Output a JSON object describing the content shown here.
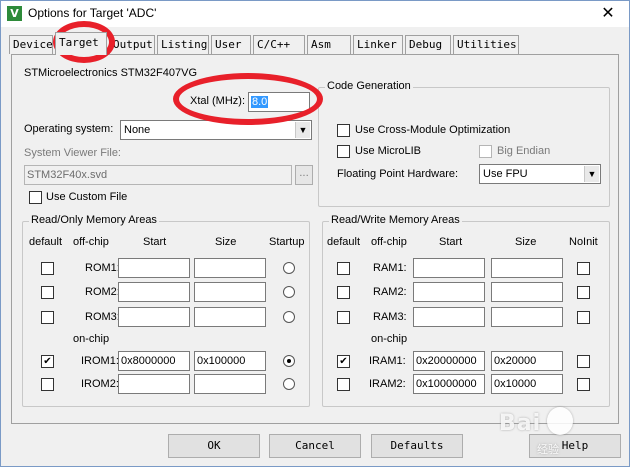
{
  "window": {
    "title": "Options for Target 'ADC'",
    "close_glyph": "✕",
    "app_icon_glyph": "V"
  },
  "tabs": [
    "Device",
    "Target",
    "Output",
    "Listing",
    "User",
    "C/C++",
    "Asm",
    "Linker",
    "Debug",
    "Utilities"
  ],
  "active_tab": "Target",
  "target": {
    "device_name": "STMicroelectronics STM32F407VG",
    "xtal_label": "Xtal (MHz):",
    "xtal_value": "8.0",
    "os_label": "Operating system:",
    "os_value": "None",
    "svf_label": "System Viewer File:",
    "svf_value": "STM32F40x.svd",
    "browse_label": "...",
    "custom_file_label": "Use Custom File",
    "custom_file_checked": false
  },
  "codegen": {
    "title": "Code Generation",
    "cross_module_label": "Use Cross-Module Optimization",
    "cross_module_checked": false,
    "microlib_label": "Use MicroLIB",
    "microlib_checked": false,
    "big_endian_label": "Big Endian",
    "big_endian_checked": false,
    "fpu_label": "Floating Point Hardware:",
    "fpu_value": "Use FPU"
  },
  "rom_areas": {
    "title": "Read/Only Memory Areas",
    "headers": {
      "default": "default",
      "offchip": "off-chip",
      "start": "Start",
      "size": "Size",
      "startup": "Startup"
    },
    "onchip_label": "on-chip",
    "rows": [
      {
        "name": "ROM1:",
        "default": false,
        "start": "",
        "size": "",
        "startup": false
      },
      {
        "name": "ROM2:",
        "default": false,
        "start": "",
        "size": "",
        "startup": false
      },
      {
        "name": "ROM3:",
        "default": false,
        "start": "",
        "size": "",
        "startup": false
      },
      {
        "name": "IROM1:",
        "default": true,
        "start": "0x8000000",
        "size": "0x100000",
        "startup": true
      },
      {
        "name": "IROM2:",
        "default": false,
        "start": "",
        "size": "",
        "startup": false
      }
    ]
  },
  "ram_areas": {
    "title": "Read/Write Memory Areas",
    "headers": {
      "default": "default",
      "offchip": "off-chip",
      "start": "Start",
      "size": "Size",
      "noinit": "NoInit"
    },
    "onchip_label": "on-chip",
    "rows": [
      {
        "name": "RAM1:",
        "default": false,
        "start": "",
        "size": "",
        "noinit": false
      },
      {
        "name": "RAM2:",
        "default": false,
        "start": "",
        "size": "",
        "noinit": false
      },
      {
        "name": "RAM3:",
        "default": false,
        "start": "",
        "size": "",
        "noinit": false
      },
      {
        "name": "IRAM1:",
        "default": true,
        "start": "0x20000000",
        "size": "0x20000",
        "noinit": false
      },
      {
        "name": "IRAM2:",
        "default": false,
        "start": "0x10000000",
        "size": "0x10000",
        "noinit": false
      }
    ]
  },
  "buttons": {
    "ok": "OK",
    "cancel": "Cancel",
    "defaults": "Defaults",
    "help": "Help"
  },
  "check_glyph": "✔",
  "combo_arrow_glyph": "▼",
  "annotation_color": "#e8202a",
  "watermark": {
    "text": "Bai",
    "subtext": "经验"
  }
}
